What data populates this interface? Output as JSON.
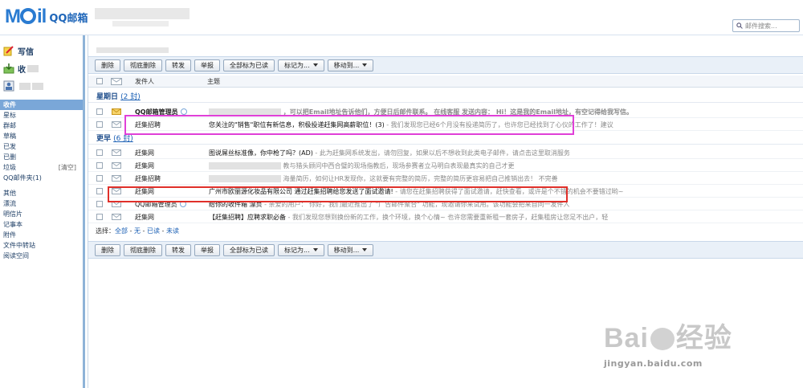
{
  "header": {
    "logo_mark": "MAil",
    "logo_text": "QQ邮箱",
    "search_placeholder": "邮件搜索..."
  },
  "nav": {
    "compose": "写信",
    "inbox": "收",
    "contacts": "",
    "items": [
      {
        "label": "收件",
        "selected": true
      },
      {
        "label": "星标"
      },
      {
        "label": "群邮"
      },
      {
        "label": "草稿"
      },
      {
        "label": "已发"
      },
      {
        "label": "已删"
      },
      {
        "label": "垃圾",
        "extra": "[清空]"
      },
      {
        "label": "QQ邮件夹(1)"
      }
    ],
    "items2": [
      {
        "label": "其他"
      },
      {
        "label": "漂流"
      },
      {
        "label": "明信片"
      },
      {
        "label": "记事本"
      },
      {
        "label": "附件"
      },
      {
        "label": "文件中转站"
      },
      {
        "label": "阅读空间"
      }
    ]
  },
  "toolbar": {
    "delete": "删除",
    "perm_delete": "彻底删除",
    "forward": "转发",
    "report": "举报",
    "mark_all_read": "全部标为已读",
    "mark_as": "标记为...",
    "move_to": "移动到..."
  },
  "columns": {
    "sender": "发件人",
    "subject": "主题"
  },
  "groups": {
    "sunday": {
      "title": "星期日",
      "count": "(2 封)"
    },
    "earlier": {
      "title": "更早",
      "count": "(6 封)"
    }
  },
  "emails": [
    {
      "sender": "QQ邮箱管理员",
      "subject": "",
      "preview": "，可以把Email地址告诉他们，方便日后邮件联系。 在线客服 发送内容： Hi！这是我的Email地址，有空记得给我写信。",
      "unread": true
    },
    {
      "sender": "赶集招聘",
      "subject": "您关注的\"销售\"职位有新信息，积极投递赶集网高薪职位！(3)",
      "preview": "- 我们发现您已经6个月没有投递简历了，也许您已经找到了心仪的工作了！建议"
    },
    {
      "sender": "赶集网",
      "subject": "图说屌丝标准像，你中枪了吗？(AD)",
      "preview": "- 此为赶集网系统发出，请勿回复，如果以后不想收到此类电子邮件，请点击这里取消服务"
    },
    {
      "sender": "赶集网",
      "subject": "",
      "preview": "教与猎头顾问中西合璧的现场指教后，现场参赛者立马明白表现最真实的自己才更"
    },
    {
      "sender": "赶集招聘",
      "subject": "",
      "preview": "海量简历，如何让HR发现你，这就要有完整的简历，完整的简历更容易把自己推销出去！ 不完善"
    },
    {
      "sender": "赶集网",
      "subject": "广州市欧丽源化妆品有限公司 通过赶集招聘给您发送了面试邀请!",
      "preview": "- 请您在赶集招聘获得了面试邀请，赶快查看，或许是个不错的机会不要错过哟~"
    },
    {
      "sender": "QQ邮箱管理员",
      "subject": "给你的收件箱 漂页",
      "preview": "- 亲爱的用户： 你好，我们最近推出了 \"广告邮件聚合\" 功能，现邀请你来试用。该功能会把来自同一发件人"
    },
    {
      "sender": "赶集网",
      "subject": "【赶集招聘】应聘求职必备",
      "preview": "- 我们发现您想到换份新的工作，换个环境，换个心情~ 也许您需要重新租一套房子，赶集租房让您足不出户，轻"
    }
  ],
  "select_line": {
    "label": "选择：",
    "all": "全部",
    "none": "无",
    "read": "已读",
    "unread": "未读"
  },
  "watermark": {
    "brand": "Bai du 经验",
    "url": "jingyan.baidu.com"
  },
  "colors": {
    "accent": "#2a7bd1",
    "highlight_magenta": "#e040d8",
    "highlight_red": "#e0302a"
  }
}
